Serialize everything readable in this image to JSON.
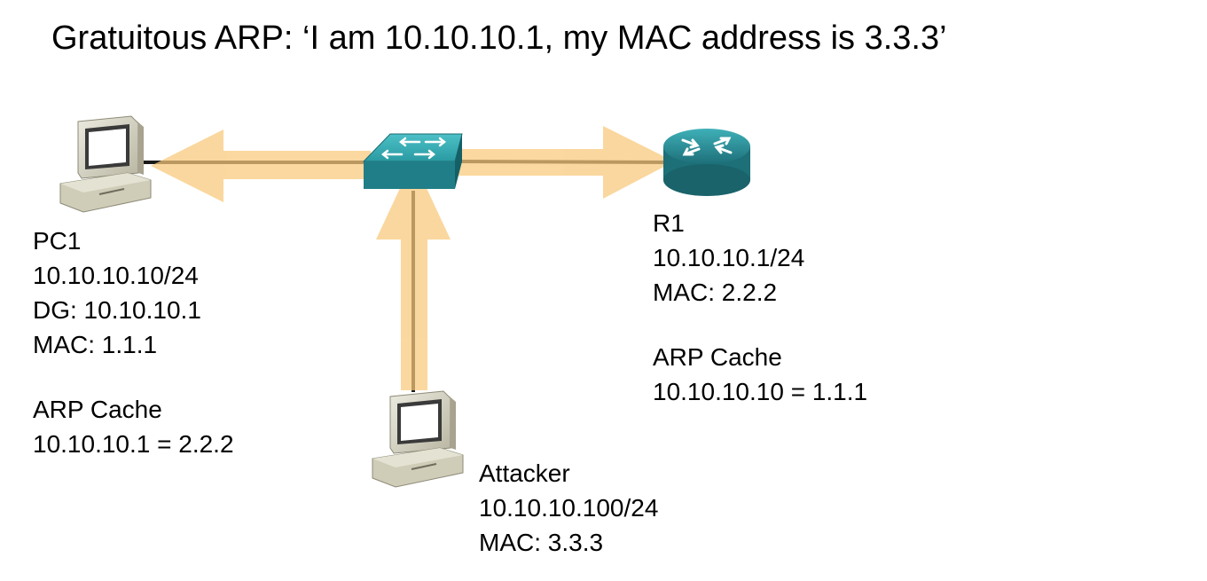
{
  "title": "Gratuitous ARP: ‘I am 10.10.10.1, my MAC address is 3.3.3’",
  "devices": {
    "pc1": {
      "name": "PC1",
      "ip": "10.10.10.10/24",
      "dg": "DG: 10.10.10.1",
      "mac": "MAC: 1.1.1",
      "arp_title": "ARP Cache",
      "arp_entry": "10.10.10.1 = 2.2.2"
    },
    "r1": {
      "name": "R1",
      "ip": "10.10.10.1/24",
      "mac": "MAC: 2.2.2",
      "arp_title": "ARP Cache",
      "arp_entry": "10.10.10.10 = 1.1.1"
    },
    "attacker": {
      "name": "Attacker",
      "ip": "10.10.10.100/24",
      "mac": "MAC: 3.3.3"
    }
  },
  "icons": [
    "pc-icon",
    "switch-icon",
    "router-icon"
  ],
  "colors": {
    "arrow": "#f9c97a",
    "link": "#1a1a1a",
    "device_teal": "#2a8f98",
    "pc_beige": "#d9d6c3"
  }
}
